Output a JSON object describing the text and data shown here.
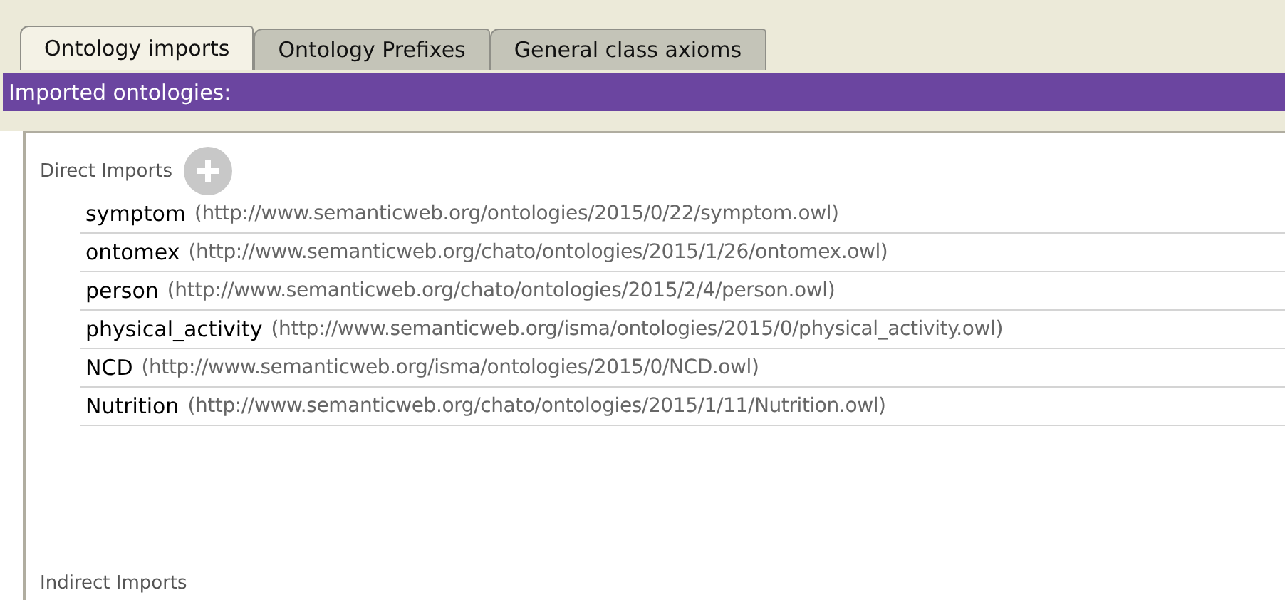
{
  "tabs": [
    {
      "label": "Ontology imports",
      "selected": true
    },
    {
      "label": "Ontology Prefixes",
      "selected": false
    },
    {
      "label": "General class axioms",
      "selected": false
    }
  ],
  "header": "Imported ontologies:",
  "direct_imports": {
    "label": "Direct Imports",
    "items": [
      {
        "name": "symptom",
        "iri": "(http://www.semanticweb.org/ontologies/2015/0/22/symptom.owl)"
      },
      {
        "name": "ontomex",
        "iri": "(http://www.semanticweb.org/chato/ontologies/2015/1/26/ontomex.owl)"
      },
      {
        "name": "person",
        "iri": "(http://www.semanticweb.org/chato/ontologies/2015/2/4/person.owl)"
      },
      {
        "name": "physical_activity",
        "iri": "(http://www.semanticweb.org/isma/ontologies/2015/0/physical_activity.owl)"
      },
      {
        "name": "NCD",
        "iri": "(http://www.semanticweb.org/isma/ontologies/2015/0/NCD.owl)"
      },
      {
        "name": "Nutrition",
        "iri": "(http://www.semanticweb.org/chato/ontologies/2015/1/11/Nutrition.owl)"
      }
    ]
  },
  "indirect_imports": {
    "label": "Indirect Imports"
  }
}
